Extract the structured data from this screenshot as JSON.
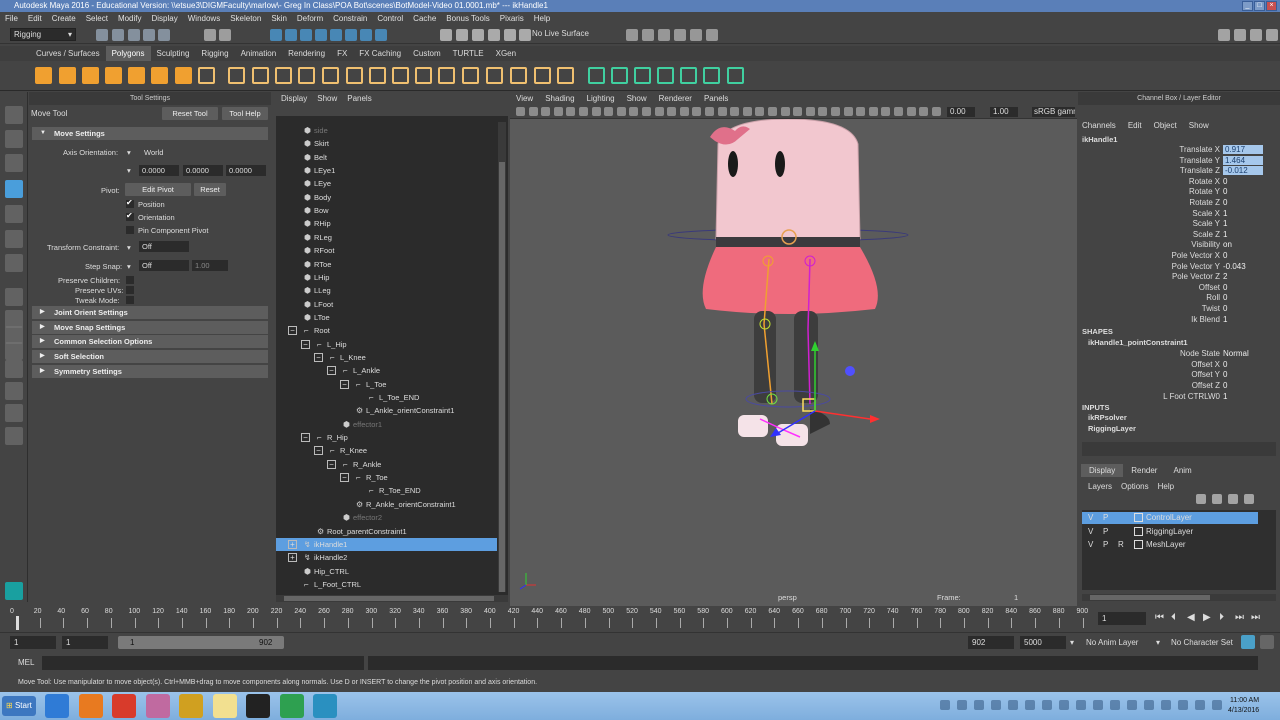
{
  "window": {
    "title": "Autodesk Maya 2016 - Educational Version: \\\\etsue3\\DIGMFaculty\\marlow\\- Greg In Class\\POA Bot\\scenes\\BotModel-Video 01.0001.mb* --- ikHandle1"
  },
  "menubar": [
    "File",
    "Edit",
    "Create",
    "Select",
    "Modify",
    "Display",
    "Windows",
    "Skeleton",
    "Skin",
    "Deform",
    "Constrain",
    "Control",
    "Cache",
    "Bonus Tools",
    "Pixaris",
    "Help"
  ],
  "statusline": {
    "mode": "Rigging",
    "live_surface": "No Live Surface"
  },
  "shelf_tabs": [
    {
      "label": "Curves / Surfaces",
      "active": false
    },
    {
      "label": "Polygons",
      "active": true
    },
    {
      "label": "Sculpting",
      "active": false
    },
    {
      "label": "Rigging",
      "active": false
    },
    {
      "label": "Animation",
      "active": false
    },
    {
      "label": "Rendering",
      "active": false
    },
    {
      "label": "FX",
      "active": false
    },
    {
      "label": "FX Caching",
      "active": false
    },
    {
      "label": "Custom",
      "active": false
    },
    {
      "label": "TURTLE",
      "active": false
    },
    {
      "label": "XGen",
      "active": false
    }
  ],
  "tool_settings": {
    "header": "Tool Settings",
    "tool_name": "Move Tool",
    "reset_tool": "Reset Tool",
    "tool_help": "Tool Help",
    "move_settings": "Move Settings",
    "axis_orientation_label": "Axis Orientation:",
    "axis_orientation_value": "World",
    "vals": [
      "0.0000",
      "0.0000",
      "0.0000"
    ],
    "pivot_label": "Pivot:",
    "edit_pivot": "Edit Pivot",
    "reset": "Reset",
    "position": "Position",
    "orientation": "Orientation",
    "pin_component_pivot": "Pin Component Pivot",
    "transform_constraint_label": "Transform Constraint:",
    "transform_constraint_value": "Off",
    "step_snap_label": "Step Snap:",
    "step_snap_value": "Off",
    "step_snap_num": "1.00",
    "preserve_children": "Preserve Children:",
    "preserve_uvs": "Preserve UVs:",
    "tweak_mode": "Tweak Mode:",
    "sections": [
      "Joint Orient Settings",
      "Move Snap Settings",
      "Common Selection Options",
      "Soft Selection",
      "Symmetry Settings"
    ]
  },
  "outliner": {
    "menus": [
      "Display",
      "Show",
      "Panels"
    ],
    "items": [
      {
        "label": "side",
        "indent": 0,
        "dim": true
      },
      {
        "label": "Skirt",
        "indent": 0
      },
      {
        "label": "Belt",
        "indent": 0
      },
      {
        "label": "LEye1",
        "indent": 0
      },
      {
        "label": "LEye",
        "indent": 0
      },
      {
        "label": "Body",
        "indent": 0
      },
      {
        "label": "Bow",
        "indent": 0
      },
      {
        "label": "RHip",
        "indent": 0
      },
      {
        "label": "RLeg",
        "indent": 0
      },
      {
        "label": "RFoot",
        "indent": 0
      },
      {
        "label": "RToe",
        "indent": 0
      },
      {
        "label": "LHip",
        "indent": 0
      },
      {
        "label": "LLeg",
        "indent": 0
      },
      {
        "label": "LFoot",
        "indent": 0
      },
      {
        "label": "LToe",
        "indent": 0
      },
      {
        "label": "Root",
        "indent": 0,
        "exp": true
      },
      {
        "label": "L_Hip",
        "indent": 1,
        "exp": true
      },
      {
        "label": "L_Knee",
        "indent": 2,
        "exp": true
      },
      {
        "label": "L_Ankle",
        "indent": 3,
        "exp": true
      },
      {
        "label": "L_Toe",
        "indent": 4,
        "exp": true
      },
      {
        "label": "L_Toe_END",
        "indent": 5
      },
      {
        "label": "L_Ankle_orientConstraint1",
        "indent": 4
      },
      {
        "label": "effector1",
        "indent": 3,
        "dim": true
      },
      {
        "label": "R_Hip",
        "indent": 1,
        "exp": true
      },
      {
        "label": "R_Knee",
        "indent": 2,
        "exp": true
      },
      {
        "label": "R_Ankle",
        "indent": 3,
        "exp": true
      },
      {
        "label": "R_Toe",
        "indent": 4,
        "exp": true
      },
      {
        "label": "R_Toe_END",
        "indent": 5
      },
      {
        "label": "R_Ankle_orientConstraint1",
        "indent": 4
      },
      {
        "label": "effector2",
        "indent": 3,
        "dim": true
      },
      {
        "label": "Root_parentConstraint1",
        "indent": 1
      },
      {
        "label": "ikHandle1",
        "indent": 0,
        "selected": true,
        "plus": true
      },
      {
        "label": "ikHandle2",
        "indent": 0,
        "plus": true
      },
      {
        "label": "Hip_CTRL",
        "indent": 0
      },
      {
        "label": "L_Foot_CTRL",
        "indent": 0
      }
    ]
  },
  "viewport": {
    "menus": [
      "View",
      "Shading",
      "Lighting",
      "Show",
      "Renderer",
      "Panels"
    ],
    "field1": "0.00",
    "field2": "1.00",
    "colorspace": "sRGB gamma",
    "camera": "persp",
    "frame_label": "Frame:",
    "frame_value": "1"
  },
  "channel_box": {
    "header": "Channel Box / Layer Editor",
    "menus": [
      "Channels",
      "Edit",
      "Object",
      "Show"
    ],
    "object": "ikHandle1",
    "attrs": [
      {
        "label": "Translate X",
        "value": "0.917",
        "hl": true
      },
      {
        "label": "Translate Y",
        "value": "1.464",
        "hl": true
      },
      {
        "label": "Translate Z",
        "value": "-0.012",
        "hl": true
      },
      {
        "label": "Rotate X",
        "value": "0"
      },
      {
        "label": "Rotate Y",
        "value": "0"
      },
      {
        "label": "Rotate Z",
        "value": "0"
      },
      {
        "label": "Scale X",
        "value": "1"
      },
      {
        "label": "Scale Y",
        "value": "1"
      },
      {
        "label": "Scale Z",
        "value": "1"
      },
      {
        "label": "Visibility",
        "value": "on"
      },
      {
        "label": "Pole Vector X",
        "value": "0"
      },
      {
        "label": "Pole Vector Y",
        "value": "-0.043"
      },
      {
        "label": "Pole Vector Z",
        "value": "2"
      },
      {
        "label": "Offset",
        "value": "0"
      },
      {
        "label": "Roll",
        "value": "0"
      },
      {
        "label": "Twist",
        "value": "0"
      },
      {
        "label": "Ik Blend",
        "value": "1"
      }
    ],
    "shapes_label": "SHAPES",
    "shape_name": "ikHandle1_pointConstraint1",
    "shape_attrs": [
      {
        "label": "Node State",
        "value": "Normal"
      },
      {
        "label": "Offset X",
        "value": "0"
      },
      {
        "label": "Offset Y",
        "value": "0"
      },
      {
        "label": "Offset Z",
        "value": "0"
      },
      {
        "label": "L Foot CTRLW0",
        "value": "1"
      }
    ],
    "inputs_label": "INPUTS",
    "inputs": [
      "ikRPsolver",
      "RiggingLayer"
    ],
    "layer_tabs": [
      "Display",
      "Render",
      "Anim"
    ],
    "layer_menus": [
      "Layers",
      "Options",
      "Help"
    ],
    "layers": [
      {
        "v": "V",
        "p": "P",
        "r": "",
        "name": "ControlLayer",
        "selected": true
      },
      {
        "v": "V",
        "p": "P",
        "r": "",
        "name": "RiggingLayer"
      },
      {
        "v": "V",
        "p": "P",
        "r": "R",
        "name": "MeshLayer"
      }
    ]
  },
  "timeline": {
    "ticks": [
      "0",
      "20",
      "40",
      "60",
      "80",
      "100",
      "120",
      "140",
      "160",
      "180",
      "200",
      "220",
      "240",
      "260",
      "280",
      "300",
      "320",
      "340",
      "360",
      "380",
      "400",
      "420",
      "440",
      "460",
      "480",
      "500",
      "520",
      "540",
      "560",
      "580",
      "600",
      "620",
      "640",
      "660",
      "680",
      "700",
      "720",
      "740",
      "760",
      "780",
      "800",
      "820",
      "840",
      "860",
      "880",
      "900"
    ],
    "current_frame": "1"
  },
  "range": {
    "start": "1",
    "start2": "1",
    "range_start": "1",
    "range_end": "902",
    "end": "902",
    "end2": "5000",
    "anim_layer": "No Anim Layer",
    "character_set": "No Character Set"
  },
  "mel": {
    "label": "MEL"
  },
  "helpline": "Move Tool: Use manipulator to move object(s). Ctrl+MMB+drag to move components along normals. Use D or INSERT to change the pivot position and axis orientation.",
  "taskbar": {
    "start": "Start",
    "time": "11:00 AM",
    "date": "4/13/2016"
  }
}
